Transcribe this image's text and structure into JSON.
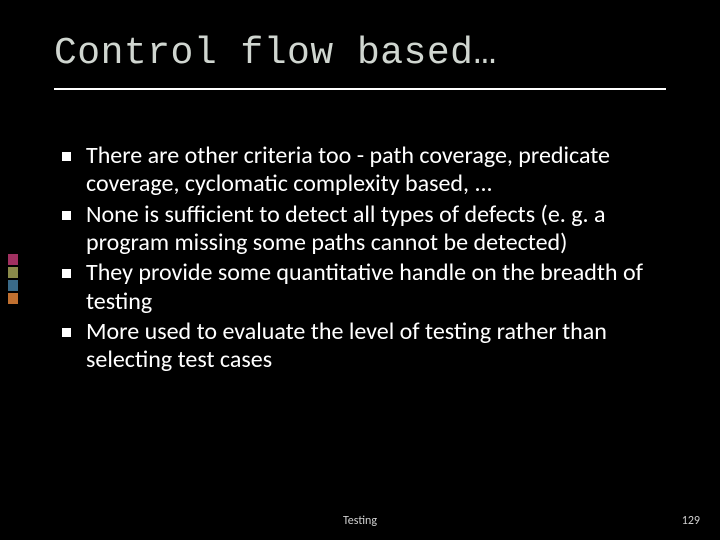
{
  "title": "Control flow based…",
  "bullets": [
    "There are other criteria too - path coverage, predicate coverage, cyclomatic complexity based, ...",
    "None is sufficient to detect all types of defects (e. g. a program missing some paths cannot be detected)",
    "They provide some quantitative handle on the breadth of testing",
    "More used to evaluate the level of testing rather than selecting test cases"
  ],
  "footer": {
    "center": "Testing",
    "page": "129"
  }
}
